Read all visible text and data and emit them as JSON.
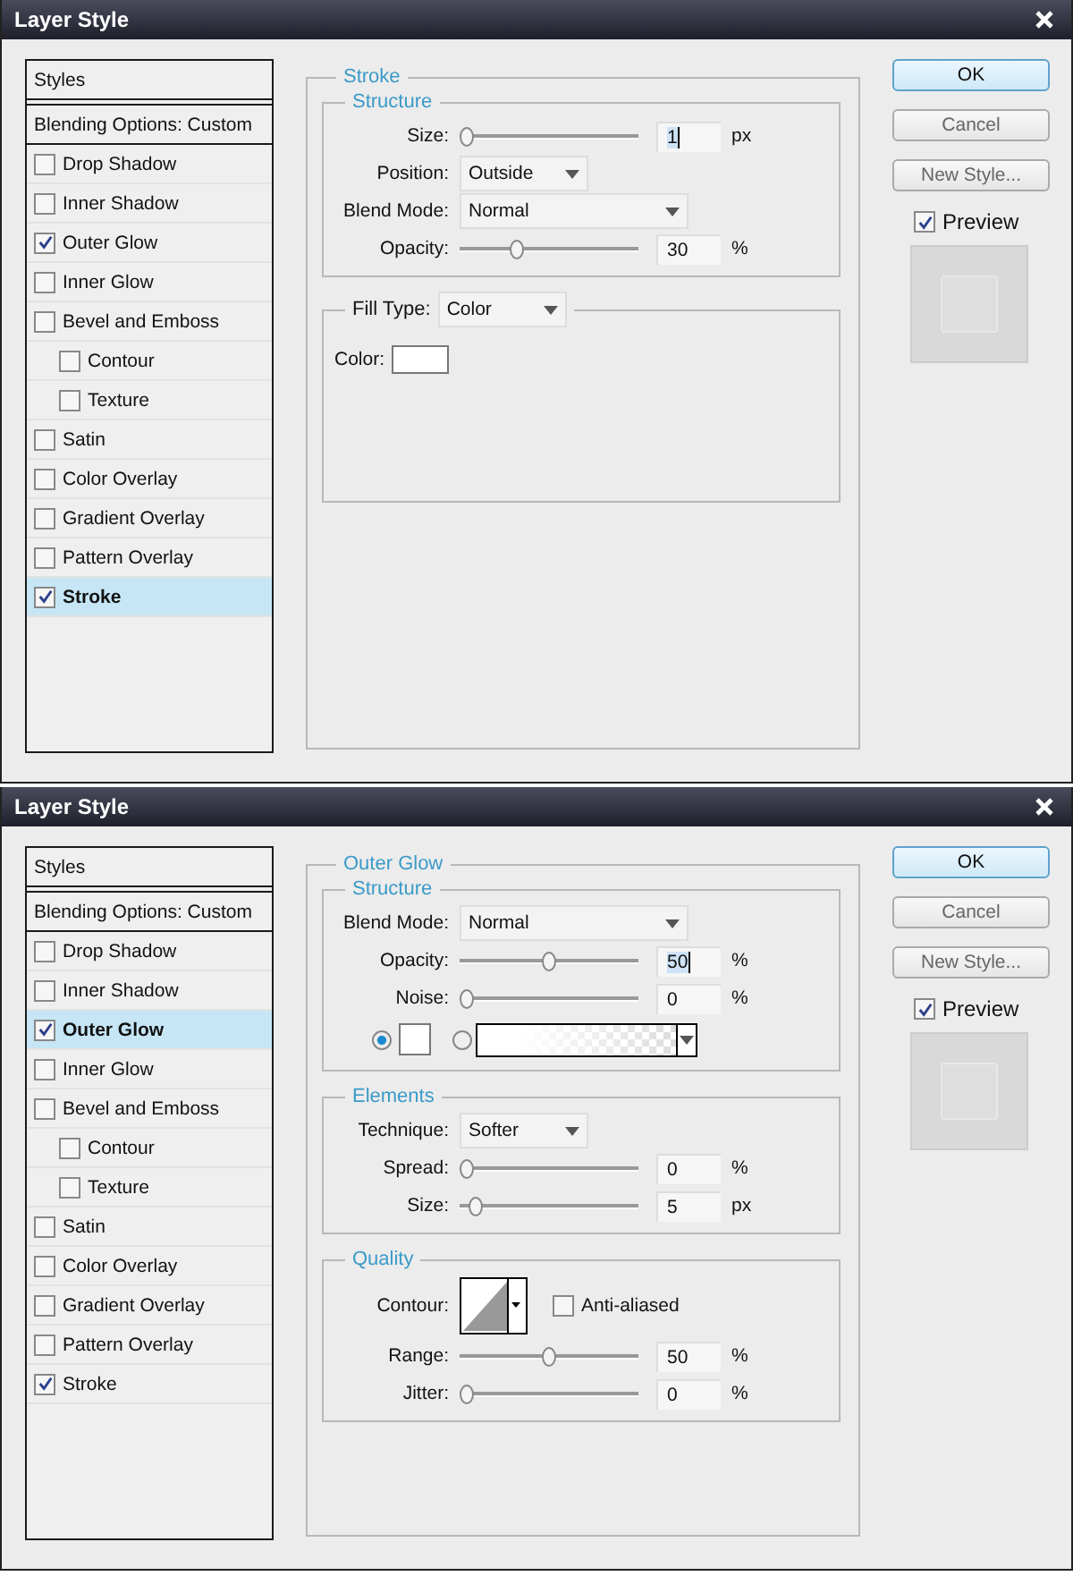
{
  "dialogs": [
    {
      "title": "Layer Style",
      "styles_header": "Styles",
      "blending": "Blending Options: Custom",
      "styles": [
        {
          "label": "Drop Shadow",
          "kind": "item",
          "checked": false,
          "selected": false
        },
        {
          "label": "Inner Shadow",
          "kind": "item",
          "checked": false,
          "selected": false
        },
        {
          "label": "Outer Glow",
          "kind": "item",
          "checked": true,
          "selected": false
        },
        {
          "label": "Inner Glow",
          "kind": "item",
          "checked": false,
          "selected": false
        },
        {
          "label": "Bevel and Emboss",
          "kind": "item",
          "checked": false,
          "selected": false
        },
        {
          "label": "Contour",
          "kind": "sub",
          "checked": false,
          "selected": false
        },
        {
          "label": "Texture",
          "kind": "sub",
          "checked": false,
          "selected": false
        },
        {
          "label": "Satin",
          "kind": "item",
          "checked": false,
          "selected": false
        },
        {
          "label": "Color Overlay",
          "kind": "item",
          "checked": false,
          "selected": false
        },
        {
          "label": "Gradient Overlay",
          "kind": "item",
          "checked": false,
          "selected": false
        },
        {
          "label": "Pattern Overlay",
          "kind": "item",
          "checked": false,
          "selected": false
        },
        {
          "label": "Stroke",
          "kind": "item",
          "checked": true,
          "selected": true
        }
      ],
      "panel": {
        "title": "Stroke",
        "groups": [
          {
            "kind": "titled",
            "title": "Structure",
            "rows": [
              {
                "kind": "slider",
                "label": "Size:",
                "level": 0,
                "value": "1",
                "unit": "px",
                "focused": true
              },
              {
                "kind": "dropdown",
                "label": "Position:",
                "value": "Outside"
              },
              {
                "kind": "wide-dropdown",
                "label": "Blend Mode:",
                "value": "Normal"
              },
              {
                "kind": "slider",
                "label": "Opacity:",
                "level": 0.3,
                "value": "30",
                "unit": "%",
                "focused": false
              }
            ]
          },
          {
            "kind": "dropdown-legend",
            "title": "Fill Type:",
            "value": "Color",
            "rows": [
              {
                "kind": "color",
                "label": "Color:"
              }
            ]
          }
        ]
      },
      "buttons": [
        {
          "label": "OK",
          "kind": "default"
        },
        {
          "label": "Cancel",
          "kind": "normal"
        },
        {
          "label": "New Style...",
          "kind": "normal"
        }
      ],
      "preview": {
        "label": "Preview",
        "checked": true
      }
    },
    {
      "title": "Layer Style",
      "styles_header": "Styles",
      "blending": "Blending Options: Custom",
      "styles": [
        {
          "label": "Drop Shadow",
          "kind": "item",
          "checked": false,
          "selected": false
        },
        {
          "label": "Inner Shadow",
          "kind": "item",
          "checked": false,
          "selected": false
        },
        {
          "label": "Outer Glow",
          "kind": "item",
          "checked": true,
          "selected": true
        },
        {
          "label": "Inner Glow",
          "kind": "item",
          "checked": false,
          "selected": false
        },
        {
          "label": "Bevel and Emboss",
          "kind": "item",
          "checked": false,
          "selected": false
        },
        {
          "label": "Contour",
          "kind": "sub",
          "checked": false,
          "selected": false
        },
        {
          "label": "Texture",
          "kind": "sub",
          "checked": false,
          "selected": false
        },
        {
          "label": "Satin",
          "kind": "item",
          "checked": false,
          "selected": false
        },
        {
          "label": "Color Overlay",
          "kind": "item",
          "checked": false,
          "selected": false
        },
        {
          "label": "Gradient Overlay",
          "kind": "item",
          "checked": false,
          "selected": false
        },
        {
          "label": "Pattern Overlay",
          "kind": "item",
          "checked": false,
          "selected": false
        },
        {
          "label": "Stroke",
          "kind": "item",
          "checked": true,
          "selected": false
        }
      ],
      "panel": {
        "title": "Outer Glow",
        "groups": [
          {
            "kind": "titled",
            "title": "Structure",
            "rows": [
              {
                "kind": "wide-dropdown",
                "label": "Blend Mode:",
                "value": "Normal"
              },
              {
                "kind": "slider",
                "label": "Opacity:",
                "level": 0.5,
                "value": "50",
                "unit": "%",
                "focused": true
              },
              {
                "kind": "slider",
                "label": "Noise:",
                "level": 0,
                "value": "0",
                "unit": "%",
                "focused": false
              },
              {
                "kind": "fill-choice",
                "options": [
                  {
                    "kind": "solid",
                    "selected": true
                  },
                  {
                    "kind": "gradient",
                    "selected": false
                  }
                ]
              }
            ]
          },
          {
            "kind": "titled",
            "title": "Elements",
            "rows": [
              {
                "kind": "dropdown",
                "label": "Technique:",
                "value": "Softer"
              },
              {
                "kind": "slider",
                "label": "Spread:",
                "level": 0,
                "value": "0",
                "unit": "%",
                "focused": false
              },
              {
                "kind": "slider",
                "label": "Size:",
                "level": 0.05,
                "value": "5",
                "unit": "px",
                "focused": false
              }
            ]
          },
          {
            "kind": "titled",
            "title": "Quality",
            "rows": [
              {
                "kind": "contour",
                "label": "Contour:",
                "option": "Anti-aliased",
                "checked": false
              },
              {
                "kind": "slider",
                "label": "Range:",
                "level": 0.5,
                "value": "50",
                "unit": "%",
                "focused": false
              },
              {
                "kind": "slider",
                "label": "Jitter:",
                "level": 0,
                "value": "0",
                "unit": "%",
                "focused": false
              }
            ]
          }
        ]
      },
      "buttons": [
        {
          "label": "OK",
          "kind": "default"
        },
        {
          "label": "Cancel",
          "kind": "normal"
        },
        {
          "label": "New Style...",
          "kind": "normal"
        }
      ],
      "preview": {
        "label": "Preview",
        "checked": true
      }
    }
  ]
}
